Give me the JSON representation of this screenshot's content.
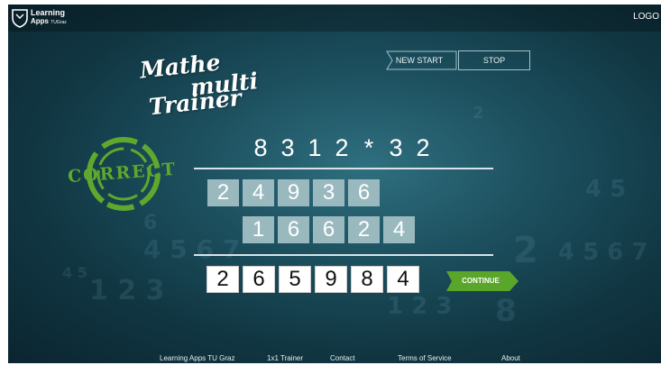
{
  "header": {
    "brand_line1": "Learning",
    "brand_line2": "Apps",
    "brand_line3": "TUGraz",
    "logo_right": "LOGO"
  },
  "title": {
    "line1": "Mathe",
    "line2": "multi",
    "line3": "Trainer"
  },
  "controls": {
    "new_start": "NEW START",
    "stop": "STOP"
  },
  "feedback": {
    "stamp": "CORRECT",
    "stamp_color": "#5fa82e"
  },
  "problem": {
    "tokens": [
      "8",
      "3",
      "1",
      "2",
      "*",
      "3",
      "2"
    ]
  },
  "partials": {
    "row1": [
      "2",
      "4",
      "9",
      "3",
      "6"
    ],
    "row2": [
      "1",
      "6",
      "6",
      "2",
      "4"
    ]
  },
  "answer": {
    "digits": [
      "2",
      "6",
      "5",
      "9",
      "8",
      "4"
    ]
  },
  "actions": {
    "continue": "CONTINUE",
    "continue_color": "#5aa62a"
  },
  "footer": {
    "links": [
      "Learning Apps TU Graz",
      "1x1 Trainer",
      "Contact",
      "Terms of Service",
      "About"
    ]
  }
}
